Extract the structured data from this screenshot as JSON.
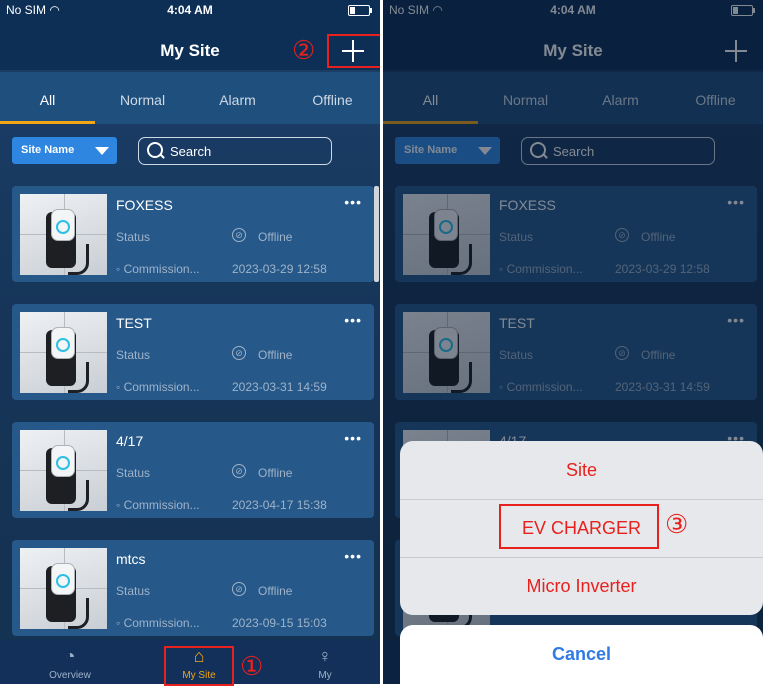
{
  "status_bar": {
    "carrier": "No SIM",
    "time": "4:04 AM",
    "wifi_icon": "wifi-icon",
    "battery_icon": "battery-icon"
  },
  "header": {
    "title": "My Site",
    "add_icon": "plus-icon"
  },
  "tabs": [
    {
      "label": "All",
      "active": true
    },
    {
      "label": "Normal",
      "active": false
    },
    {
      "label": "Alarm",
      "active": false
    },
    {
      "label": "Offline",
      "active": false
    }
  ],
  "filter": {
    "select_value": "Site Name",
    "search_placeholder": "Search"
  },
  "sites": [
    {
      "name": "FOXESS",
      "status_label": "Status",
      "status": "Offline",
      "comm_label": "Commission...",
      "comm_date": "2023-03-29 12:58"
    },
    {
      "name": "TEST",
      "status_label": "Status",
      "status": "Offline",
      "comm_label": "Commission...",
      "comm_date": "2023-03-31 14:59"
    },
    {
      "name": "4/17",
      "status_label": "Status",
      "status": "Offline",
      "comm_label": "Commission...",
      "comm_date": "2023-04-17 15:38"
    },
    {
      "name": "mtcs",
      "status_label": "Status",
      "status": "Offline",
      "comm_label": "Commission...",
      "comm_date": "2023-09-15 15:03"
    }
  ],
  "more_icon": "•••",
  "bottom_nav": [
    {
      "label": "Overview",
      "icon": "chart-icon",
      "active": false
    },
    {
      "label": "My Site",
      "icon": "home-icon",
      "active": true
    },
    {
      "label": "My",
      "icon": "user-icon",
      "active": false
    }
  ],
  "annotations": {
    "step1": "①",
    "step2": "②",
    "step3": "③"
  },
  "action_sheet": {
    "options": [
      "Site",
      "EV CHARGER",
      "Micro Inverter"
    ],
    "cancel": "Cancel"
  },
  "colors": {
    "accent": "#f3a515",
    "annotation": "#e8211e",
    "sheet_option": "#e8211e",
    "cancel": "#2f7ae5"
  }
}
